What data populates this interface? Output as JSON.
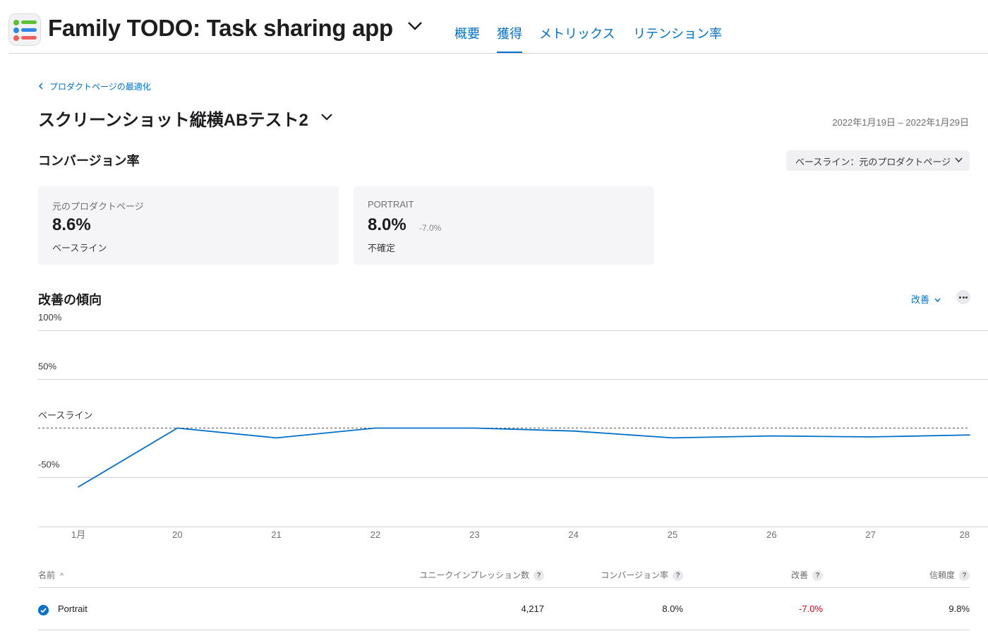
{
  "header": {
    "app_title": "Family TODO: Task sharing app",
    "tabs": [
      {
        "label": "概要",
        "active": false
      },
      {
        "label": "獲得",
        "active": true
      },
      {
        "label": "メトリックス",
        "active": false
      },
      {
        "label": "リテンション率",
        "active": false
      }
    ]
  },
  "breadcrumb": "プロダクトページの最適化",
  "page": {
    "title": "スクリーンショット縦横ABテスト2",
    "date_range": "2022年1月19日 – 2022年1月29日"
  },
  "conversion": {
    "section_title": "コンバージョン率",
    "baseline_select": "ベースライン：元のプロダクトページ",
    "cards": [
      {
        "label": "元のプロダクトページ",
        "value": "8.6%",
        "delta": "",
        "sub": "ベースライン"
      },
      {
        "label": "PORTRAIT",
        "value": "8.0%",
        "delta": "-7.0%",
        "sub": "不確定"
      }
    ]
  },
  "trend": {
    "section_title": "改善の傾向",
    "metric_select": "改善"
  },
  "chart_data": {
    "type": "line",
    "x": [
      "1月",
      "20",
      "21",
      "22",
      "23",
      "24",
      "25",
      "26",
      "27",
      "28"
    ],
    "series": [
      {
        "name": "Portrait",
        "color": "#0070c9",
        "values": [
          -60,
          0,
          -10,
          0,
          0,
          -3,
          -10,
          -8,
          -9,
          -7
        ]
      }
    ],
    "baseline": {
      "label": "ベースライン",
      "value": 0
    },
    "y_ticks": [
      {
        "value": 100,
        "label": "100%"
      },
      {
        "value": 50,
        "label": "50%"
      },
      {
        "value": 0,
        "label": "ベースライン"
      },
      {
        "value": -50,
        "label": "-50%"
      }
    ],
    "ylim": [
      -100,
      100
    ],
    "grid": true
  },
  "table": {
    "columns": [
      {
        "label": "名前",
        "sort": "^"
      },
      {
        "label": "ユニークインプレッション数",
        "help": "?"
      },
      {
        "label": "コンバージョン率",
        "help": "?"
      },
      {
        "label": "改善",
        "help": "?"
      },
      {
        "label": "信頼度",
        "help": "?"
      }
    ],
    "rows": [
      {
        "name": "Portrait",
        "impressions": "4,217",
        "conversion": "8.0%",
        "improvement": "-7.0%",
        "confidence": "9.8%",
        "selected": true
      }
    ],
    "negative_color": "#d70015"
  }
}
